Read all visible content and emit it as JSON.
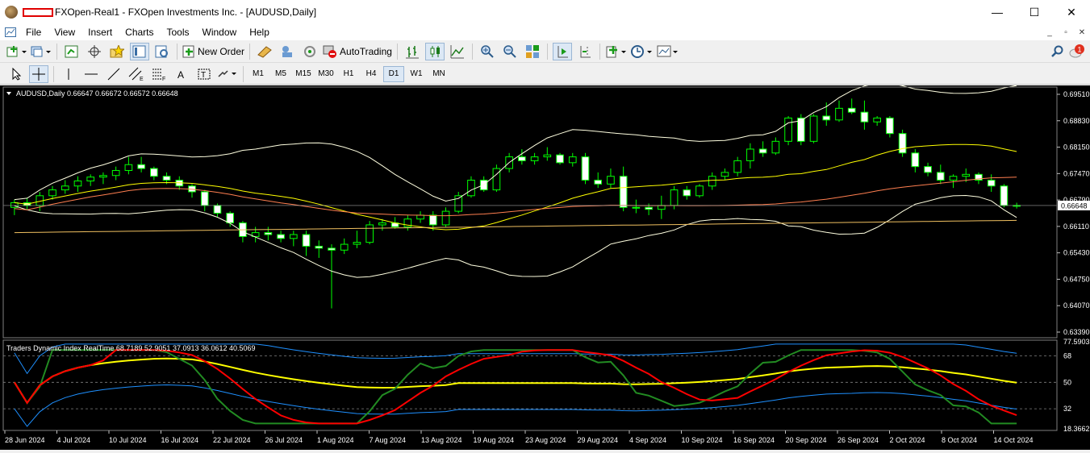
{
  "window": {
    "title": "FXOpen-Real1 - FXOpen Investments Inc. - [AUDUSD,Daily]",
    "minimize": "—",
    "maximize": "☐",
    "close": "✕"
  },
  "menu": {
    "items": [
      "File",
      "View",
      "Insert",
      "Charts",
      "Tools",
      "Window",
      "Help"
    ],
    "mdi": [
      "_",
      "▫",
      "✕"
    ]
  },
  "toolbar": {
    "new_order": "New Order",
    "autotrading": "AutoTrading",
    "notification_count": "1"
  },
  "timeframes": [
    "M1",
    "M5",
    "M15",
    "M30",
    "H1",
    "H4",
    "D1",
    "W1",
    "MN"
  ],
  "active_timeframe": "D1",
  "chart": {
    "header": "AUDUSD,Daily  0.66647 0.66672 0.66572 0.66648",
    "symbol": "AUDUSD",
    "timeframe": "Daily",
    "bid": "0.66648",
    "price_axis": [
      "0.69510",
      "0.68830",
      "0.68150",
      "0.67470",
      "0.66790",
      "0.66110",
      "0.65430",
      "0.64750",
      "0.64070",
      "0.63390"
    ],
    "indicator_header": "Traders Dynamic Index RealTime 68.7189 52.9051 37.0913 36.0612 40.5069",
    "indicator_axis": [
      "77.5903",
      "68",
      "50",
      "32",
      "18.3662"
    ],
    "date_axis": [
      "28 Jun 2024",
      "4 Jul 2024",
      "10 Jul 2024",
      "16 Jul 2024",
      "22 Jul 2024",
      "26 Jul 2024",
      "1 Aug 2024",
      "7 Aug 2024",
      "13 Aug 2024",
      "19 Aug 2024",
      "23 Aug 2024",
      "29 Aug 2024",
      "4 Sep 2024",
      "10 Sep 2024",
      "16 Sep 2024",
      "20 Sep 2024",
      "26 Sep 2024",
      "2 Oct 2024",
      "8 Oct 2024",
      "14 Oct 2024"
    ],
    "colors": {
      "bull": "#000000",
      "bear": "#ffffff",
      "wick": "#00ff00",
      "background": "#000000",
      "bb": "#ffffe0",
      "ma_short": "#ffff00",
      "ma_long": "#ff7f50",
      "tdi_green": "#228b22",
      "tdi_red": "#ff0000",
      "tdi_yellow": "#ffff00",
      "tdi_blue": "#1e90ff"
    }
  },
  "chart_data": {
    "type": "candlestick",
    "y_range": [
      0.6339,
      0.6951
    ],
    "candles": [
      [
        0.666,
        0.668,
        0.664,
        0.6672
      ],
      [
        0.6672,
        0.6685,
        0.6655,
        0.6665
      ],
      [
        0.6665,
        0.67,
        0.665,
        0.669
      ],
      [
        0.669,
        0.6715,
        0.668,
        0.6705
      ],
      [
        0.6705,
        0.673,
        0.6695,
        0.6715
      ],
      [
        0.6715,
        0.674,
        0.67,
        0.6728
      ],
      [
        0.6728,
        0.6745,
        0.6715,
        0.6738
      ],
      [
        0.6738,
        0.675,
        0.672,
        0.6742
      ],
      [
        0.6742,
        0.6765,
        0.673,
        0.6755
      ],
      [
        0.6755,
        0.679,
        0.6745,
        0.677
      ],
      [
        0.677,
        0.679,
        0.675,
        0.676
      ],
      [
        0.676,
        0.6765,
        0.673,
        0.674
      ],
      [
        0.674,
        0.675,
        0.672,
        0.673
      ],
      [
        0.673,
        0.674,
        0.6705,
        0.6715
      ],
      [
        0.6715,
        0.672,
        0.6685,
        0.67
      ],
      [
        0.67,
        0.6705,
        0.665,
        0.6665
      ],
      [
        0.6665,
        0.667,
        0.6635,
        0.6645
      ],
      [
        0.6645,
        0.665,
        0.661,
        0.662
      ],
      [
        0.662,
        0.6625,
        0.657,
        0.6585
      ],
      [
        0.6585,
        0.661,
        0.657,
        0.6595
      ],
      [
        0.6595,
        0.661,
        0.6575,
        0.659
      ],
      [
        0.659,
        0.66,
        0.657,
        0.658
      ],
      [
        0.658,
        0.66,
        0.656,
        0.659
      ],
      [
        0.659,
        0.66,
        0.6535,
        0.656
      ],
      [
        0.656,
        0.6575,
        0.653,
        0.6555
      ],
      [
        0.6555,
        0.6565,
        0.64,
        0.655
      ],
      [
        0.655,
        0.658,
        0.654,
        0.6565
      ],
      [
        0.6565,
        0.66,
        0.6555,
        0.657
      ],
      [
        0.657,
        0.6625,
        0.6565,
        0.6615
      ],
      [
        0.6615,
        0.663,
        0.66,
        0.662
      ],
      [
        0.662,
        0.6635,
        0.6605,
        0.661
      ],
      [
        0.661,
        0.664,
        0.66,
        0.663
      ],
      [
        0.663,
        0.665,
        0.662,
        0.664
      ],
      [
        0.664,
        0.665,
        0.66,
        0.6615
      ],
      [
        0.6615,
        0.666,
        0.661,
        0.665
      ],
      [
        0.665,
        0.67,
        0.6645,
        0.669
      ],
      [
        0.669,
        0.674,
        0.6685,
        0.673
      ],
      [
        0.673,
        0.674,
        0.67,
        0.6705
      ],
      [
        0.6705,
        0.677,
        0.67,
        0.676
      ],
      [
        0.676,
        0.68,
        0.675,
        0.679
      ],
      [
        0.679,
        0.681,
        0.677,
        0.678
      ],
      [
        0.678,
        0.68,
        0.677,
        0.679
      ],
      [
        0.679,
        0.6815,
        0.678,
        0.6795
      ],
      [
        0.6795,
        0.68,
        0.677,
        0.6775
      ],
      [
        0.6775,
        0.68,
        0.6765,
        0.679
      ],
      [
        0.679,
        0.68,
        0.672,
        0.673
      ],
      [
        0.673,
        0.675,
        0.671,
        0.672
      ],
      [
        0.672,
        0.676,
        0.671,
        0.674
      ],
      [
        0.674,
        0.6765,
        0.665,
        0.666
      ],
      [
        0.666,
        0.668,
        0.6645,
        0.666
      ],
      [
        0.666,
        0.667,
        0.664,
        0.6655
      ],
      [
        0.6655,
        0.669,
        0.663,
        0.6665
      ],
      [
        0.6665,
        0.6715,
        0.6655,
        0.6705
      ],
      [
        0.6705,
        0.6715,
        0.668,
        0.669
      ],
      [
        0.669,
        0.672,
        0.6685,
        0.6715
      ],
      [
        0.6715,
        0.675,
        0.6705,
        0.674
      ],
      [
        0.674,
        0.676,
        0.673,
        0.675
      ],
      [
        0.675,
        0.679,
        0.674,
        0.678
      ],
      [
        0.678,
        0.6825,
        0.676,
        0.681
      ],
      [
        0.681,
        0.683,
        0.679,
        0.68
      ],
      [
        0.68,
        0.684,
        0.6795,
        0.683
      ],
      [
        0.683,
        0.6895,
        0.682,
        0.689
      ],
      [
        0.689,
        0.69,
        0.682,
        0.683
      ],
      [
        0.683,
        0.69,
        0.6825,
        0.6895
      ],
      [
        0.6895,
        0.693,
        0.687,
        0.6885
      ],
      [
        0.6885,
        0.6935,
        0.688,
        0.6915
      ],
      [
        0.6915,
        0.694,
        0.69,
        0.6905
      ],
      [
        0.6905,
        0.6935,
        0.686,
        0.688
      ],
      [
        0.688,
        0.6895,
        0.687,
        0.689
      ],
      [
        0.689,
        0.6895,
        0.684,
        0.685
      ],
      [
        0.685,
        0.686,
        0.679,
        0.68
      ],
      [
        0.68,
        0.681,
        0.675,
        0.6765
      ],
      [
        0.6765,
        0.6775,
        0.674,
        0.675
      ],
      [
        0.675,
        0.677,
        0.672,
        0.673
      ],
      [
        0.673,
        0.6745,
        0.671,
        0.674
      ],
      [
        0.674,
        0.676,
        0.6725,
        0.6745
      ],
      [
        0.6745,
        0.675,
        0.672,
        0.673
      ],
      [
        0.673,
        0.6745,
        0.67,
        0.6715
      ],
      [
        0.6715,
        0.672,
        0.666,
        0.6665
      ],
      [
        0.6665,
        0.6672,
        0.6657,
        0.6665
      ]
    ]
  }
}
